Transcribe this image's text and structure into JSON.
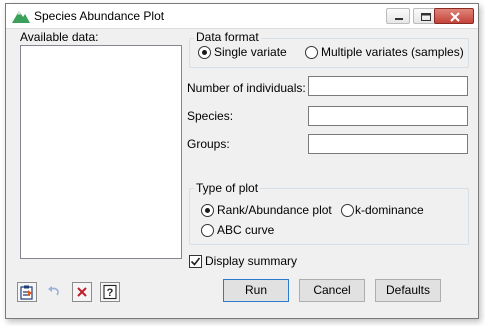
{
  "window": {
    "title": "Species Abundance Plot",
    "icon": "mountain-app-icon",
    "controls": [
      "minimize-icon",
      "maximize-icon",
      "close-icon"
    ]
  },
  "available_data": {
    "label": "Available data:",
    "items": []
  },
  "data_format": {
    "legend": "Data format",
    "options": [
      "Single variate",
      "Multiple variates (samples)"
    ],
    "selected": "Single variate"
  },
  "fields": {
    "number_of_individuals": {
      "label": "Number of individuals:",
      "value": ""
    },
    "species": {
      "label": "Species:",
      "value": ""
    },
    "groups": {
      "label": "Groups:",
      "value": ""
    }
  },
  "type_of_plot": {
    "legend": "Type of plot",
    "options": [
      "Rank/Abundance plot",
      "k-dominance",
      "ABC curve"
    ],
    "selected": "Rank/Abundance plot"
  },
  "display_summary": {
    "label": "Display summary",
    "checked": true
  },
  "buttons": {
    "run": "Run",
    "cancel": "Cancel",
    "defaults": "Defaults"
  },
  "toolbar_icons": [
    "clipboard-icon",
    "undo-icon",
    "clear-icon",
    "help-icon"
  ]
}
